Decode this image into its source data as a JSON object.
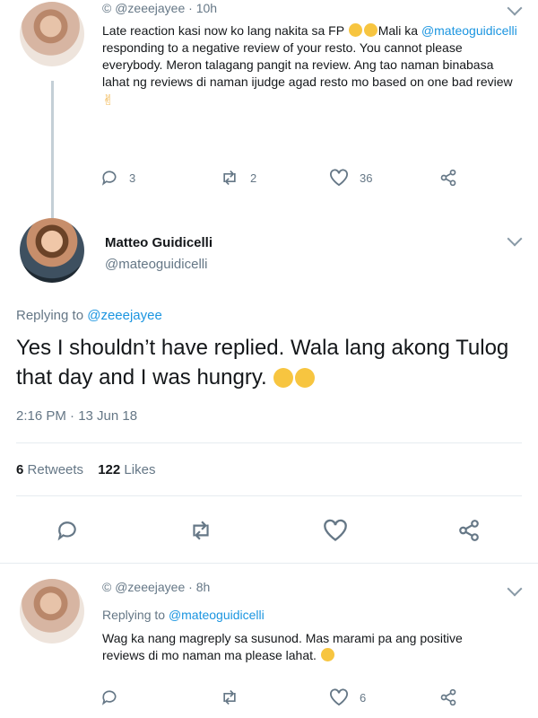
{
  "tweet1": {
    "handle": "@zeeejayee",
    "time": "10h",
    "text_a": "Late reaction kasi now ko lang nakita sa FP",
    "text_b": "Mali ka",
    "mention": "@mateoguidicelli",
    "text_c": " responding to a negative review of your resto. You cannot please everybody. Meron talagang pangit na review. Ang tao naman binabasa lahat ng reviews di naman ijudge agad resto mo based on one bad review",
    "reply_count": "3",
    "retweet_count": "2",
    "like_count": "36"
  },
  "main": {
    "name": "Matteo Guidicelli",
    "handle": "@mateoguidicelli",
    "replying_label": "Replying to ",
    "replying_to": "@zeeejayee",
    "text": "Yes I shouldn’t have replied. Wala lang akong Tulog that day and I was hungry.",
    "timestamp": "2:16 PM · 13 Jun 18",
    "retweets_count": "6",
    "retweets_label": "Retweets",
    "likes_count": "122",
    "likes_label": "Likes"
  },
  "tweet2": {
    "handle": "@zeeejayee",
    "time": "8h",
    "replying_label": "Replying to ",
    "replying_to": "@mateoguidicelli",
    "text": "Wag ka nang magreply sa susunod. Mas marami pa ang positive reviews di mo naman ma please lahat.",
    "like_count": "6"
  },
  "icons": [
    "reply-icon",
    "retweet-icon",
    "like-icon",
    "share-icon",
    "chevron-down-icon"
  ],
  "colors": {
    "link": "#1b95e0",
    "muted": "#657786",
    "text": "#14171a",
    "separator": "#e6ecf0"
  }
}
